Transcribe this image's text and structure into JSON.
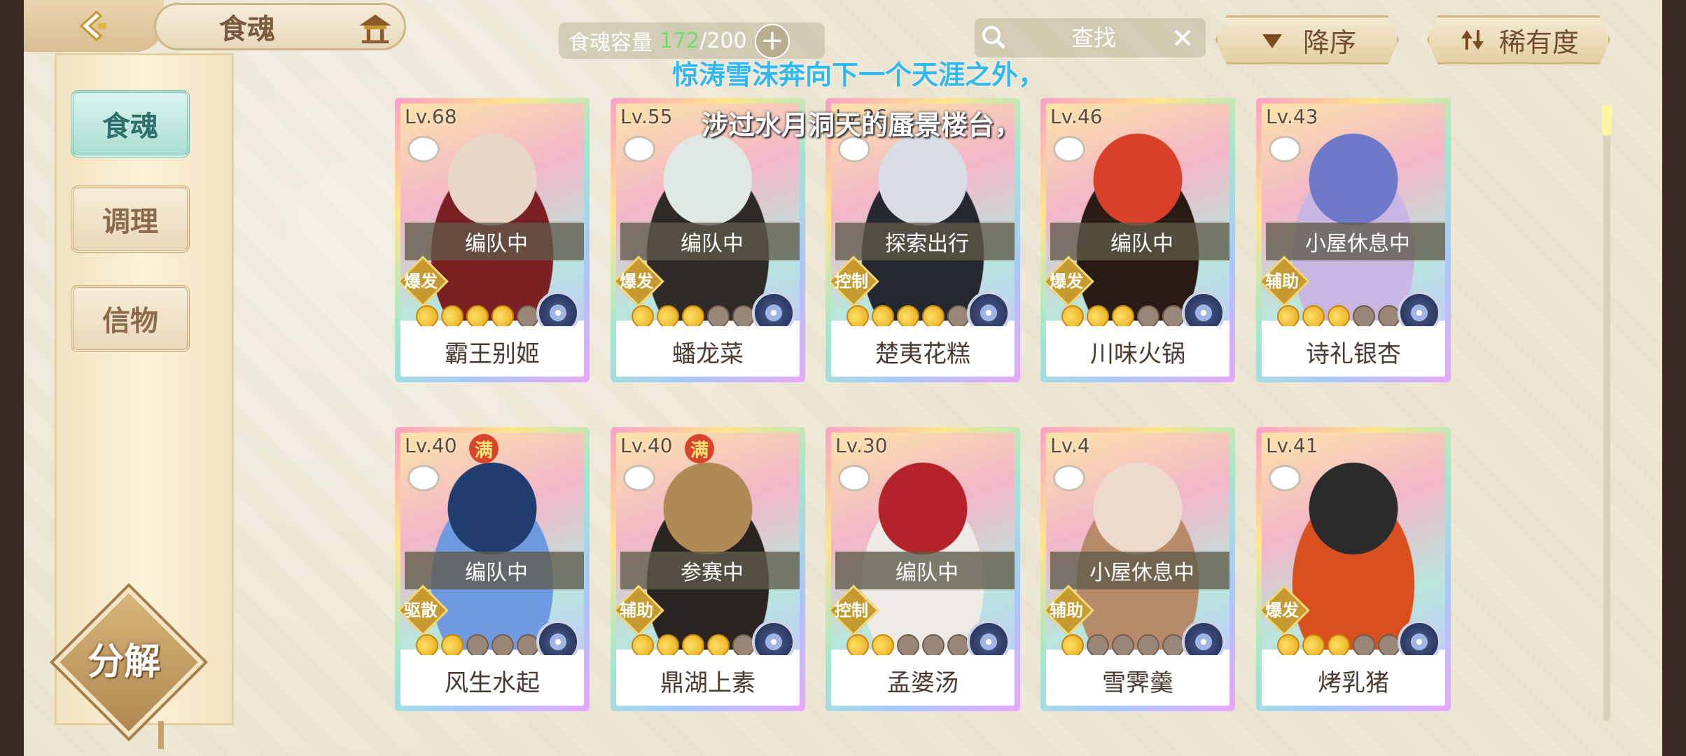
{
  "header": {
    "title": "食魂",
    "back_icon": "back-arrow-icon",
    "home_icon": "pavilion-icon"
  },
  "capacity": {
    "label": "食魂容量",
    "current": "172",
    "max": "/200"
  },
  "search": {
    "placeholder": "查找"
  },
  "sort": {
    "order_label": "降序",
    "rarity_label": "稀有度"
  },
  "sidebar": {
    "items": [
      {
        "label": "食魂",
        "active": true
      },
      {
        "label": "调理",
        "active": false
      },
      {
        "label": "信物",
        "active": false
      }
    ],
    "decompose_label": "分解"
  },
  "subtitles": {
    "line1": "惊涛雪沫奔向下一个天涯之外，",
    "line2": "涉过水月洞天的蜃景楼台，"
  },
  "cards": [
    {
      "level": "Lv.68",
      "status": "编队中",
      "role": "爆发",
      "stars": 4,
      "name": "霸王别姬",
      "full": false,
      "colors": [
        "#7a1f22",
        "#e8d6c7"
      ]
    },
    {
      "level": "Lv.55",
      "status": "编队中",
      "role": "爆发",
      "stars": 3,
      "name": "蟠龙菜",
      "full": false,
      "colors": [
        "#2d2a28",
        "#dfe8e2"
      ]
    },
    {
      "level": "Lv.26",
      "status": "探索出行",
      "role": "控制",
      "stars": 4,
      "name": "楚夷花糕",
      "full": false,
      "colors": [
        "#262830",
        "#d8dde6"
      ]
    },
    {
      "level": "Lv.46",
      "status": "编队中",
      "role": "爆发",
      "stars": 3,
      "name": "川味火锅",
      "full": false,
      "colors": [
        "#2a1a14",
        "#d9402a"
      ]
    },
    {
      "level": "Lv.43",
      "status": "小屋休息中",
      "role": "辅助",
      "stars": 3,
      "name": "诗礼银杏",
      "full": false,
      "colors": [
        "#c9b6e2",
        "#6e78c9"
      ]
    },
    {
      "level": "Lv.40",
      "status": "编队中",
      "role": "驱散",
      "stars": 2,
      "name": "风生水起",
      "full": true,
      "colors": [
        "#6f9ae0",
        "#213d6e"
      ]
    },
    {
      "level": "Lv.40",
      "status": "参赛中",
      "role": "辅助",
      "stars": 4,
      "name": "鼎湖上素",
      "full": true,
      "colors": [
        "#2a2420",
        "#b08a55"
      ]
    },
    {
      "level": "Lv.30",
      "status": "编队中",
      "role": "控制",
      "stars": 2,
      "name": "孟婆汤",
      "full": false,
      "colors": [
        "#eeeae6",
        "#b5232a"
      ]
    },
    {
      "level": "Lv.4",
      "status": "小屋休息中",
      "role": "辅助",
      "stars": 1,
      "name": "雪霁羹",
      "full": false,
      "colors": [
        "#b98a6a",
        "#eed9cf"
      ]
    },
    {
      "level": "Lv.41",
      "status": "",
      "role": "爆发",
      "stars": 3,
      "name": "烤乳猪",
      "full": false,
      "colors": [
        "#d9501f",
        "#2b2b2b"
      ]
    }
  ]
}
